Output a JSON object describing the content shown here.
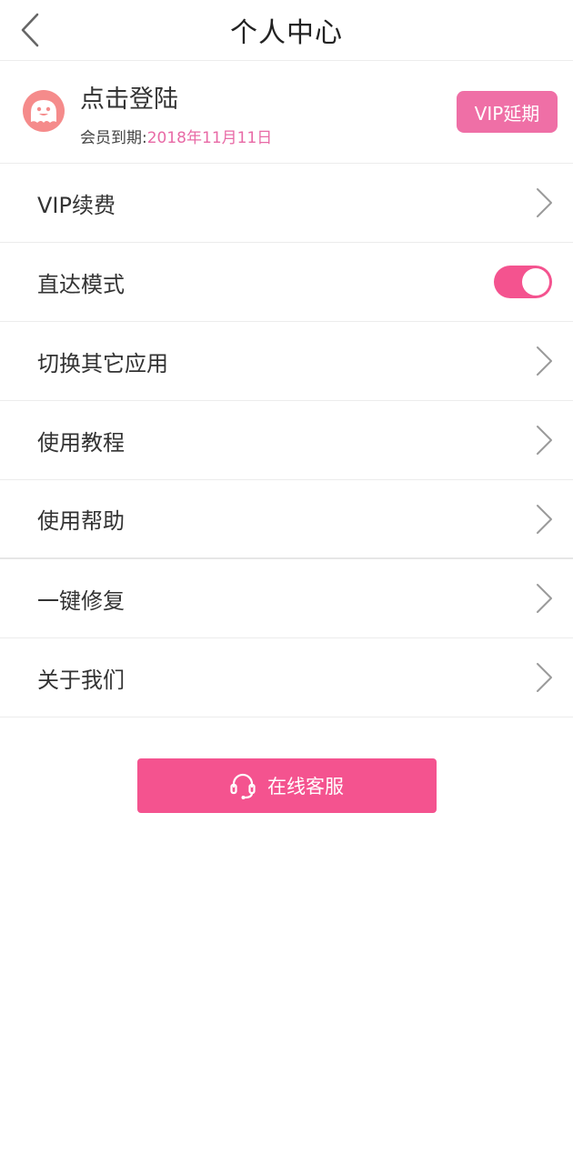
{
  "header": {
    "title": "个人中心",
    "back_icon": "chevron-left-icon"
  },
  "profile": {
    "login_text": "点击登陆",
    "expire_label": "会员到期:",
    "expire_date": "2018年11月11日",
    "vip_button": "VIP延期",
    "avatar_icon": "smiley-avatar-icon"
  },
  "menu": {
    "items": [
      {
        "label": "VIP续费",
        "control": "chevron"
      },
      {
        "label": "直达模式",
        "control": "toggle",
        "toggle_on": true
      },
      {
        "label": "切换其它应用",
        "control": "chevron"
      },
      {
        "label": "使用教程",
        "control": "chevron"
      },
      {
        "label": "使用帮助",
        "control": "chevron"
      },
      {
        "label": "一键修复",
        "control": "chevron"
      },
      {
        "label": "关于我们",
        "control": "chevron"
      }
    ]
  },
  "service": {
    "label": "在线客服",
    "icon": "headset-icon"
  },
  "colors": {
    "accent": "#f4538f",
    "vip_button": "#ef6fa6",
    "date_text": "#e86aa6",
    "avatar": "#f58b8b"
  }
}
